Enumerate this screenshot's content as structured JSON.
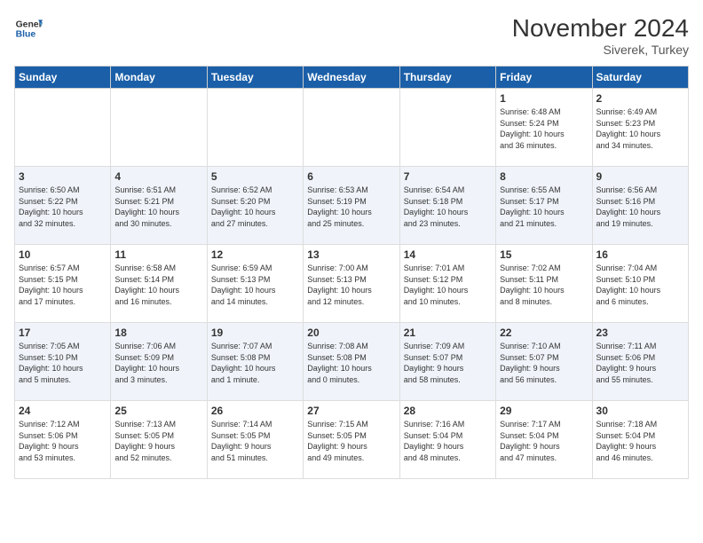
{
  "header": {
    "logo_line1": "General",
    "logo_line2": "Blue",
    "month": "November 2024",
    "location": "Siverek, Turkey"
  },
  "weekdays": [
    "Sunday",
    "Monday",
    "Tuesday",
    "Wednesday",
    "Thursday",
    "Friday",
    "Saturday"
  ],
  "rows": [
    {
      "days": [
        {
          "num": "",
          "info": ""
        },
        {
          "num": "",
          "info": ""
        },
        {
          "num": "",
          "info": ""
        },
        {
          "num": "",
          "info": ""
        },
        {
          "num": "",
          "info": ""
        },
        {
          "num": "1",
          "info": "Sunrise: 6:48 AM\nSunset: 5:24 PM\nDaylight: 10 hours\nand 36 minutes."
        },
        {
          "num": "2",
          "info": "Sunrise: 6:49 AM\nSunset: 5:23 PM\nDaylight: 10 hours\nand 34 minutes."
        }
      ]
    },
    {
      "days": [
        {
          "num": "3",
          "info": "Sunrise: 6:50 AM\nSunset: 5:22 PM\nDaylight: 10 hours\nand 32 minutes."
        },
        {
          "num": "4",
          "info": "Sunrise: 6:51 AM\nSunset: 5:21 PM\nDaylight: 10 hours\nand 30 minutes."
        },
        {
          "num": "5",
          "info": "Sunrise: 6:52 AM\nSunset: 5:20 PM\nDaylight: 10 hours\nand 27 minutes."
        },
        {
          "num": "6",
          "info": "Sunrise: 6:53 AM\nSunset: 5:19 PM\nDaylight: 10 hours\nand 25 minutes."
        },
        {
          "num": "7",
          "info": "Sunrise: 6:54 AM\nSunset: 5:18 PM\nDaylight: 10 hours\nand 23 minutes."
        },
        {
          "num": "8",
          "info": "Sunrise: 6:55 AM\nSunset: 5:17 PM\nDaylight: 10 hours\nand 21 minutes."
        },
        {
          "num": "9",
          "info": "Sunrise: 6:56 AM\nSunset: 5:16 PM\nDaylight: 10 hours\nand 19 minutes."
        }
      ]
    },
    {
      "days": [
        {
          "num": "10",
          "info": "Sunrise: 6:57 AM\nSunset: 5:15 PM\nDaylight: 10 hours\nand 17 minutes."
        },
        {
          "num": "11",
          "info": "Sunrise: 6:58 AM\nSunset: 5:14 PM\nDaylight: 10 hours\nand 16 minutes."
        },
        {
          "num": "12",
          "info": "Sunrise: 6:59 AM\nSunset: 5:13 PM\nDaylight: 10 hours\nand 14 minutes."
        },
        {
          "num": "13",
          "info": "Sunrise: 7:00 AM\nSunset: 5:13 PM\nDaylight: 10 hours\nand 12 minutes."
        },
        {
          "num": "14",
          "info": "Sunrise: 7:01 AM\nSunset: 5:12 PM\nDaylight: 10 hours\nand 10 minutes."
        },
        {
          "num": "15",
          "info": "Sunrise: 7:02 AM\nSunset: 5:11 PM\nDaylight: 10 hours\nand 8 minutes."
        },
        {
          "num": "16",
          "info": "Sunrise: 7:04 AM\nSunset: 5:10 PM\nDaylight: 10 hours\nand 6 minutes."
        }
      ]
    },
    {
      "days": [
        {
          "num": "17",
          "info": "Sunrise: 7:05 AM\nSunset: 5:10 PM\nDaylight: 10 hours\nand 5 minutes."
        },
        {
          "num": "18",
          "info": "Sunrise: 7:06 AM\nSunset: 5:09 PM\nDaylight: 10 hours\nand 3 minutes."
        },
        {
          "num": "19",
          "info": "Sunrise: 7:07 AM\nSunset: 5:08 PM\nDaylight: 10 hours\nand 1 minute."
        },
        {
          "num": "20",
          "info": "Sunrise: 7:08 AM\nSunset: 5:08 PM\nDaylight: 10 hours\nand 0 minutes."
        },
        {
          "num": "21",
          "info": "Sunrise: 7:09 AM\nSunset: 5:07 PM\nDaylight: 9 hours\nand 58 minutes."
        },
        {
          "num": "22",
          "info": "Sunrise: 7:10 AM\nSunset: 5:07 PM\nDaylight: 9 hours\nand 56 minutes."
        },
        {
          "num": "23",
          "info": "Sunrise: 7:11 AM\nSunset: 5:06 PM\nDaylight: 9 hours\nand 55 minutes."
        }
      ]
    },
    {
      "days": [
        {
          "num": "24",
          "info": "Sunrise: 7:12 AM\nSunset: 5:06 PM\nDaylight: 9 hours\nand 53 minutes."
        },
        {
          "num": "25",
          "info": "Sunrise: 7:13 AM\nSunset: 5:05 PM\nDaylight: 9 hours\nand 52 minutes."
        },
        {
          "num": "26",
          "info": "Sunrise: 7:14 AM\nSunset: 5:05 PM\nDaylight: 9 hours\nand 51 minutes."
        },
        {
          "num": "27",
          "info": "Sunrise: 7:15 AM\nSunset: 5:05 PM\nDaylight: 9 hours\nand 49 minutes."
        },
        {
          "num": "28",
          "info": "Sunrise: 7:16 AM\nSunset: 5:04 PM\nDaylight: 9 hours\nand 48 minutes."
        },
        {
          "num": "29",
          "info": "Sunrise: 7:17 AM\nSunset: 5:04 PM\nDaylight: 9 hours\nand 47 minutes."
        },
        {
          "num": "30",
          "info": "Sunrise: 7:18 AM\nSunset: 5:04 PM\nDaylight: 9 hours\nand 46 minutes."
        }
      ]
    }
  ]
}
